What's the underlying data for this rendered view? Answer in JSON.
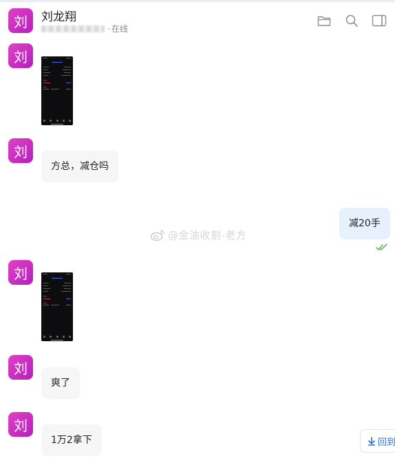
{
  "header": {
    "avatar_char": "刘",
    "contact_name": "刘龙翔",
    "status_sep": "·",
    "status_text": "在线",
    "icons": [
      "folder-icon",
      "search-icon",
      "side-panel-icon"
    ]
  },
  "messages": [
    {
      "id": "m1",
      "from": "刘龙翔",
      "avatar_char": "刘",
      "type": "image"
    },
    {
      "id": "m2",
      "from": "刘龙翔",
      "avatar_char": "刘",
      "type": "text",
      "text": "方总，减仓吗"
    },
    {
      "id": "m3",
      "from": "self",
      "type": "text",
      "text": "减20手",
      "read": true
    },
    {
      "id": "m4",
      "from": "刘龙翔",
      "avatar_char": "刘",
      "type": "image"
    },
    {
      "id": "m5",
      "from": "刘龙翔",
      "avatar_char": "刘",
      "type": "text",
      "text": "爽了"
    },
    {
      "id": "m6",
      "from": "刘龙翔",
      "avatar_char": "刘",
      "type": "text",
      "text": "1万2拿下"
    }
  ],
  "watermark": "@金油收割-老方",
  "back_to_bottom": {
    "label": "回到",
    "icon": "arrow-down-icon"
  },
  "colors": {
    "avatar": "#d02fc2",
    "self_bubble": "#e7f1fd",
    "other_bubble": "#f6f6f6",
    "read_check": "#4caf50",
    "link_blue": "#2f6fd6"
  }
}
